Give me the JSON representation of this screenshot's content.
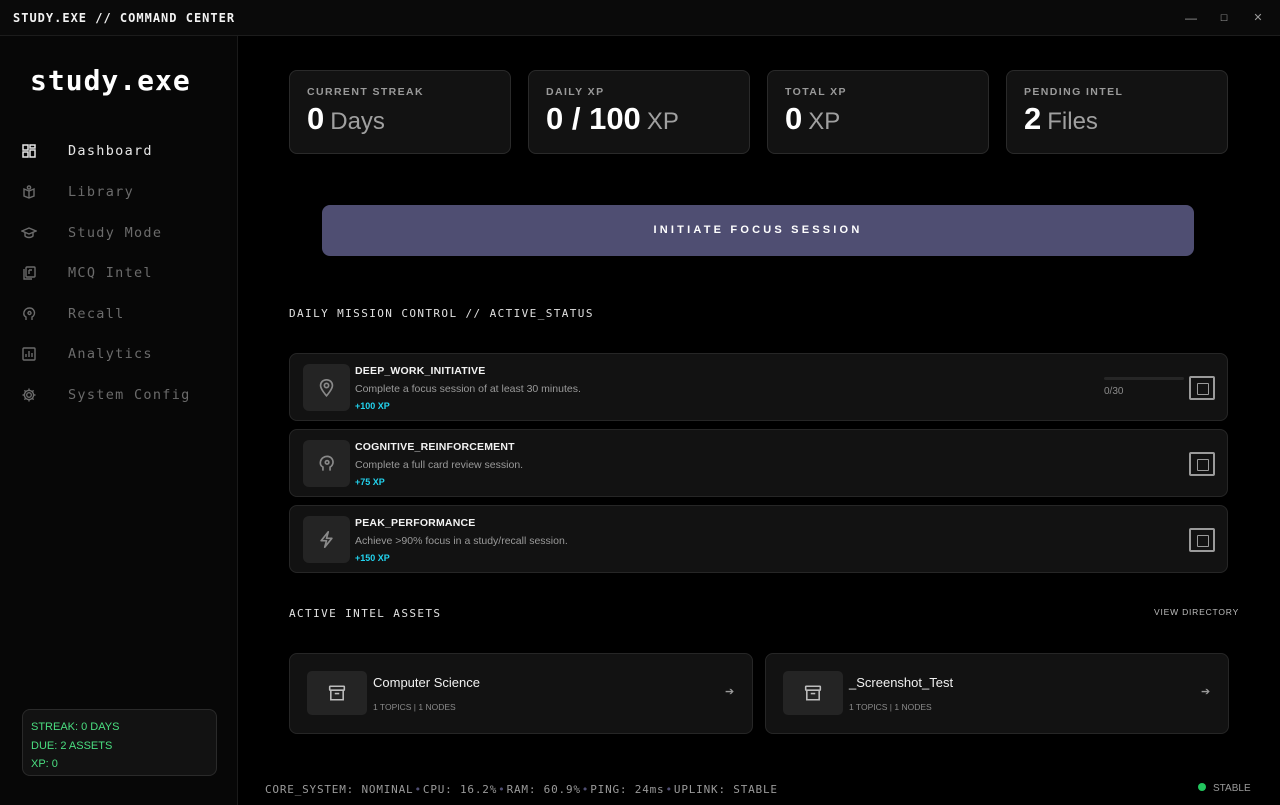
{
  "window": {
    "title": "STUDY.EXE // COMMAND CENTER",
    "controls": {
      "minimize": "—",
      "maximize": "☐",
      "close": "✕"
    }
  },
  "sidebar": {
    "logo": "study.exe",
    "items": [
      {
        "label": "Dashboard",
        "icon": "grid-icon",
        "active": true
      },
      {
        "label": "Library",
        "icon": "book-icon",
        "active": false
      },
      {
        "label": "Study Mode",
        "icon": "graduation-cap-icon",
        "active": false
      },
      {
        "label": "MCQ Intel",
        "icon": "copy-icon",
        "active": false
      },
      {
        "label": "Recall",
        "icon": "brain-icon",
        "active": false
      },
      {
        "label": "Analytics",
        "icon": "bar-chart-icon",
        "active": false
      },
      {
        "label": "System Config",
        "icon": "gear-icon",
        "active": false
      }
    ],
    "status": {
      "streak": "STREAK: 0 DAYS",
      "due": "DUE: 2 ASSETS",
      "xp": "XP: 0"
    },
    "status_color": "#4ade80"
  },
  "stats": [
    {
      "label": "CURRENT STREAK",
      "value": "0",
      "unit": "Days"
    },
    {
      "label": "DAILY XP",
      "value": "0 / 100",
      "unit": "XP"
    },
    {
      "label": "TOTAL XP",
      "value": "0",
      "unit": "XP"
    },
    {
      "label": "PENDING INTEL",
      "value": "2",
      "unit": "Files"
    }
  ],
  "focus_button": "INITIATE FOCUS SESSION",
  "accent_color": "#4f4e72",
  "missions": {
    "title": "DAILY MISSION CONTROL // ACTIVE_STATUS",
    "items": [
      {
        "title": "DEEP_WORK_INITIATIVE",
        "desc": "Complete a focus session of at least 30 minutes.",
        "xp": "+100 XP",
        "icon": "map-pin-icon",
        "progress_text": "0/30",
        "progress": 0
      },
      {
        "title": "COGNITIVE_REINFORCEMENT",
        "desc": "Complete a full card review session.",
        "xp": "+75 XP",
        "icon": "brain-icon"
      },
      {
        "title": "PEAK_PERFORMANCE",
        "desc": "Achieve >90% focus in a study/recall session.",
        "xp": "+150 XP",
        "icon": "lightning-icon"
      }
    ],
    "xp_color": "#22d3ee"
  },
  "assets": {
    "title": "ACTIVE INTEL ASSETS",
    "view_directory": "VIEW DIRECTORY",
    "items": [
      {
        "title": "Computer Science",
        "meta": "1 TOPICS | 1 NODES",
        "icon": "archive-icon",
        "arrow": "➔"
      },
      {
        "title": "_Screenshot_Test",
        "meta": "1 TOPICS | 1 NODES",
        "icon": "archive-icon",
        "arrow": "➔"
      }
    ]
  },
  "footer": {
    "core": "CORE_SYSTEM: NOMINAL",
    "cpu": "CPU: 16.2%",
    "ram": "RAM: 60.9%",
    "ping": "PING: 24ms",
    "uplink": "UPLINK: STABLE",
    "separator": "•",
    "status": "STABLE",
    "status_color": "#22c55e"
  }
}
